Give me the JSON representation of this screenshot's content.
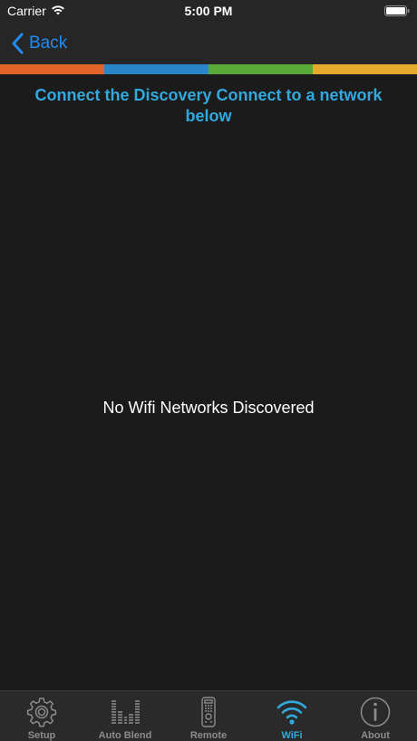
{
  "status_bar": {
    "carrier": "Carrier",
    "time": "5:00 PM",
    "icons": [
      "wifi-signal-icon",
      "battery-icon"
    ]
  },
  "nav": {
    "back_label": "Back",
    "back_icon": "chevron-left-icon",
    "accent_color": "#1f8bf3"
  },
  "color_strip": [
    "#e2642a",
    "#2a86c9",
    "#5aaa3a",
    "#e3aa2c"
  ],
  "main": {
    "heading": "Connect the Discovery Connect to a network below",
    "empty_message": "No Wifi Networks Discovered",
    "heading_color": "#33a8dc"
  },
  "tabs": [
    {
      "label": "Setup",
      "icon": "gear-icon",
      "active": false
    },
    {
      "label": "Auto Blend",
      "icon": "equalizer-icon",
      "active": false
    },
    {
      "label": "Remote",
      "icon": "remote-control-icon",
      "active": false
    },
    {
      "label": "WiFi",
      "icon": "wifi-icon",
      "active": true
    },
    {
      "label": "About",
      "icon": "info-icon",
      "active": false
    }
  ]
}
